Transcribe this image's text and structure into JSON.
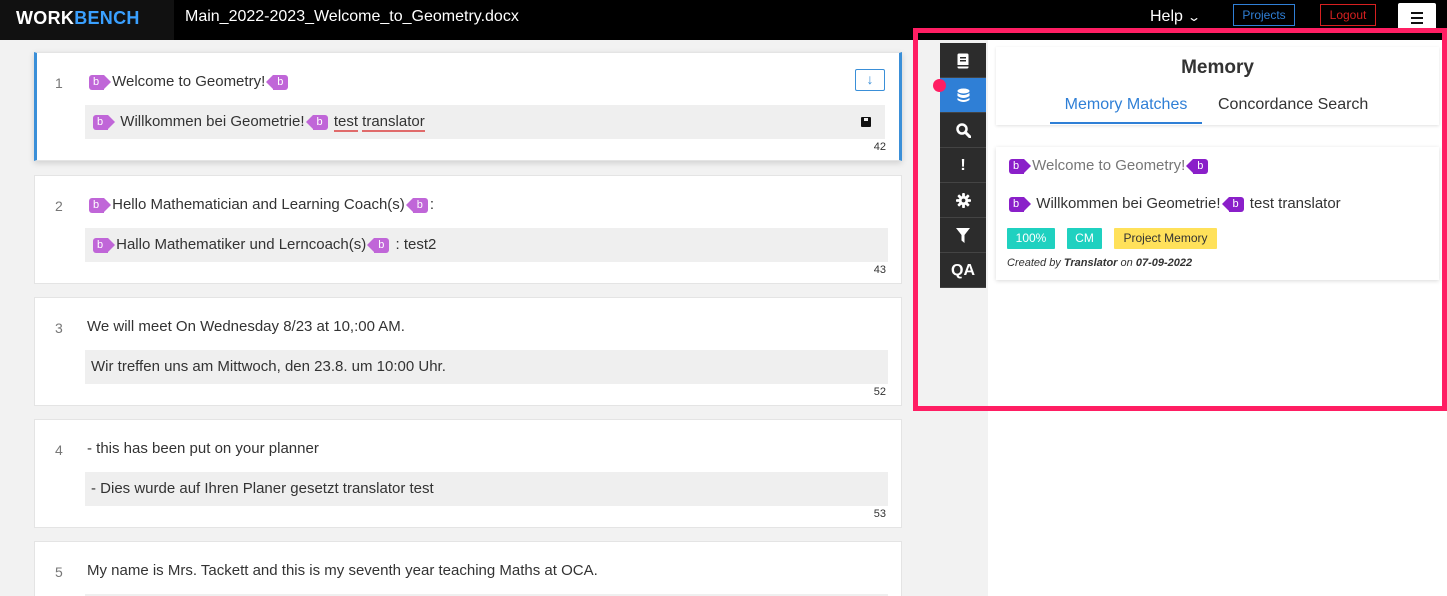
{
  "header": {
    "brand_part1": "WORK",
    "brand_part2": "BENCH",
    "document_title": "Main_2022-2023_Welcome_to_Geometry.docx",
    "help_label": "Help",
    "projects_label": "Projects",
    "logout_label": "Logout"
  },
  "colors": {
    "accent": "#2f7fd6",
    "tag": "#c066d8",
    "highlight": "#ff1e63",
    "match_badge": "#1fd1c0",
    "memory_badge": "#ffe15a"
  },
  "tag_label": "b",
  "segments": [
    {
      "number": "1",
      "source": "Welcome to  Geometry!",
      "target_text": "Willkommen bei Geometrie!",
      "target_extra1": "test",
      "target_extra2": "translator",
      "char_count": "42",
      "active": true
    },
    {
      "number": "2",
      "source": "Hello Mathematician and Learning Coach(s)",
      "source_suffix": ":",
      "target_text": "Hallo Mathematiker und Lerncoach(s)",
      "target_suffix": " : test2",
      "char_count": "43"
    },
    {
      "number": "3",
      "source": "We will meet On Wednesday 8/23 at 10,:00 AM.",
      "target_text": "Wir treffen uns am Mittwoch, den 23.8. um 10:00 Uhr.",
      "char_count": "52"
    },
    {
      "number": "4",
      "source": "- this has been put on your planner",
      "target_text": "- Dies wurde auf Ihren Planer gesetzt translator test",
      "char_count": "53"
    },
    {
      "number": "5",
      "source": "My name is Mrs. Tackett and this is my seventh year teaching Maths at OCA."
    }
  ],
  "side_tools": [
    {
      "name": "document-icon"
    },
    {
      "name": "database-icon",
      "active": true
    },
    {
      "name": "search-icon"
    },
    {
      "name": "exclamation-icon",
      "label": "!"
    },
    {
      "name": "gear-icon"
    },
    {
      "name": "filter-icon"
    },
    {
      "name": "qa-tool",
      "label": "QA"
    }
  ],
  "memory_panel": {
    "title": "Memory",
    "tabs": [
      "Memory Matches",
      "Concordance Search"
    ],
    "active_tab": "Memory Matches",
    "match": {
      "source": "Welcome to Geometry!",
      "target": "Willkommen bei Geometrie!",
      "target_suffix": " test translator",
      "match_percent": "100%",
      "match_type": "CM",
      "memory_name": "Project Memory",
      "created_prefix": "Created by",
      "created_by": "Translator",
      "created_on_label": "on",
      "created_date": "07-09-2022"
    }
  }
}
